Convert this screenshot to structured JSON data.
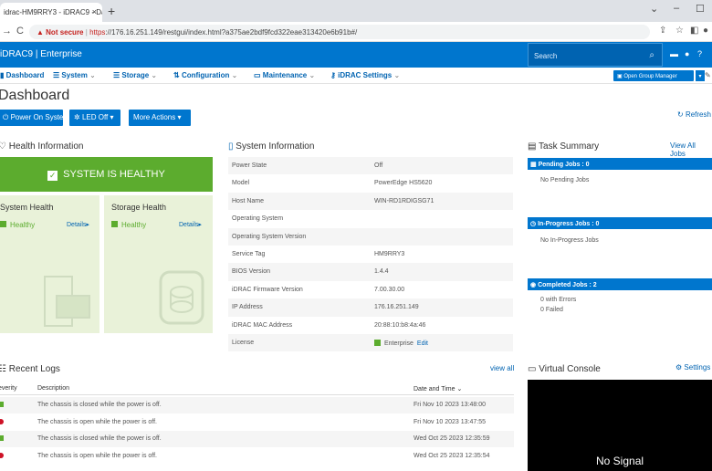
{
  "browser": {
    "tab_title": "idrac-HM9RRY3 - iDRAC9 - Das",
    "tab_close": "×",
    "new_tab": "+",
    "not_secure": "Not secure",
    "url_https": "https",
    "url_rest": "://176.16.251.149/restgui/index.html?a375ae2bdf9fcd322eae313420e6b91b#/"
  },
  "header": {
    "brand": "iDRAC9 | Enterprise",
    "search_placeholder": "Search"
  },
  "menu": {
    "dashboard": "Dashboard",
    "system": "System",
    "storage": "Storage",
    "configuration": "Configuration",
    "maintenance": "Maintenance",
    "idrac_settings": "iDRAC Settings",
    "open_group_manager": "Open Group Manager"
  },
  "page": {
    "title": "Dashboard",
    "power_on": "Power On System",
    "led_off": "LED Off",
    "more_actions": "More Actions",
    "refresh": "Refresh"
  },
  "health": {
    "title": "Health Information",
    "banner": "SYSTEM IS HEALTHY",
    "system_health_title": "System Health",
    "system_health_status": "Healthy",
    "storage_health_title": "Storage Health",
    "storage_health_status": "Healthy",
    "details": "Details"
  },
  "system_info": {
    "title": "System Information",
    "rows": [
      {
        "label": "Power State",
        "value": "Off"
      },
      {
        "label": "Model",
        "value": "PowerEdge HS5620"
      },
      {
        "label": "Host Name",
        "value": "WIN-RD1RDIGSG71"
      },
      {
        "label": "Operating System",
        "value": ""
      },
      {
        "label": "Operating System Version",
        "value": ""
      },
      {
        "label": "Service Tag",
        "value": "HM9RRY3"
      },
      {
        "label": "BIOS Version",
        "value": "1.4.4"
      },
      {
        "label": "iDRAC Firmware Version",
        "value": "7.00.30.00"
      },
      {
        "label": "IP Address",
        "value": "176.16.251.149"
      },
      {
        "label": "iDRAC MAC Address",
        "value": "20:88:10:b8:4a:46"
      },
      {
        "label": "License",
        "value": "Enterprise"
      }
    ],
    "edit": "Edit"
  },
  "tasks": {
    "title": "Task Summary",
    "view_all": "View All Jobs",
    "pending_header": "Pending Jobs : 0",
    "pending_text": "No Pending Jobs",
    "inprogress_header": "In-Progress Jobs : 0",
    "inprogress_text": "No In-Progress Jobs",
    "completed_header": "Completed Jobs : 2",
    "completed_errors": "0  with Errors",
    "completed_failed": "0  Failed"
  },
  "logs": {
    "title": "Recent Logs",
    "view_all": "view all",
    "col_severity": "everity",
    "col_description": "Description",
    "col_date": "Date and Time",
    "rows": [
      {
        "severity": "ok",
        "description": "The chassis is closed while the power is off.",
        "date": "Fri Nov 10 2023 13:48:00"
      },
      {
        "severity": "critical",
        "description": "The chassis is open while the power is off.",
        "date": "Fri Nov 10 2023 13:47:55"
      },
      {
        "severity": "ok",
        "description": "The chassis is closed while the power is off.",
        "date": "Wed Oct 25 2023 12:35:59"
      },
      {
        "severity": "critical",
        "description": "The chassis is open while the power is off.",
        "date": "Wed Oct 25 2023 12:35:54"
      }
    ]
  },
  "virtual_console": {
    "title": "Virtual Console",
    "settings": "Settings",
    "status": "No Signal"
  },
  "colors": {
    "dell_blue": "#0076ce",
    "healthy_green": "#5cac2e",
    "critical_red": "#ce1126"
  },
  "icons": [
    "warning-icon",
    "search-icon",
    "gear-icon",
    "server-icon",
    "storage-icon",
    "clipboard-icon",
    "monitor-icon"
  ]
}
